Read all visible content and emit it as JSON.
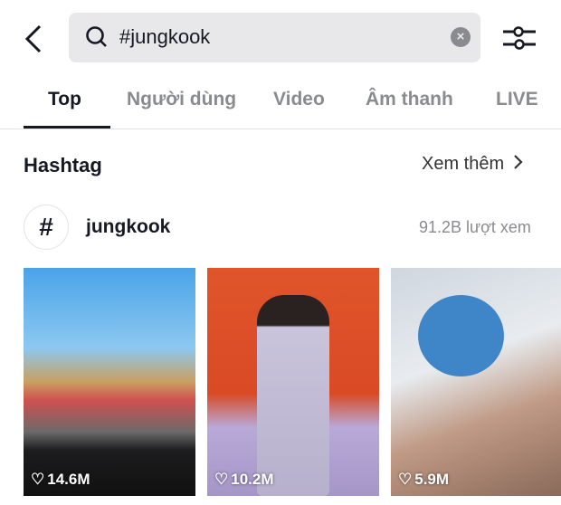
{
  "header": {
    "back_icon": "chevron-left-icon",
    "search": {
      "icon": "search-icon",
      "value": "#jungkook",
      "clear_icon": "close-icon"
    },
    "filter_icon": "sliders-icon"
  },
  "tabs": [
    {
      "label": "Top",
      "active": true
    },
    {
      "label": "Người dùng"
    },
    {
      "label": "Video"
    },
    {
      "label": "Âm thanh"
    },
    {
      "label": "LIVE"
    }
  ],
  "hashtag_section": {
    "title": "Hashtag",
    "more_label": "Xem thêm",
    "more_icon": "chevron-right-icon",
    "item": {
      "icon": "#",
      "name": "jungkook",
      "views": "91.2B lượt xem"
    }
  },
  "videos": [
    {
      "likes": "14.6M"
    },
    {
      "likes": "10.2M"
    },
    {
      "likes": "5.9M"
    }
  ],
  "colors": {
    "text": "#161823",
    "muted": "#8a8b91",
    "search_bg": "#e8e8ea"
  }
}
